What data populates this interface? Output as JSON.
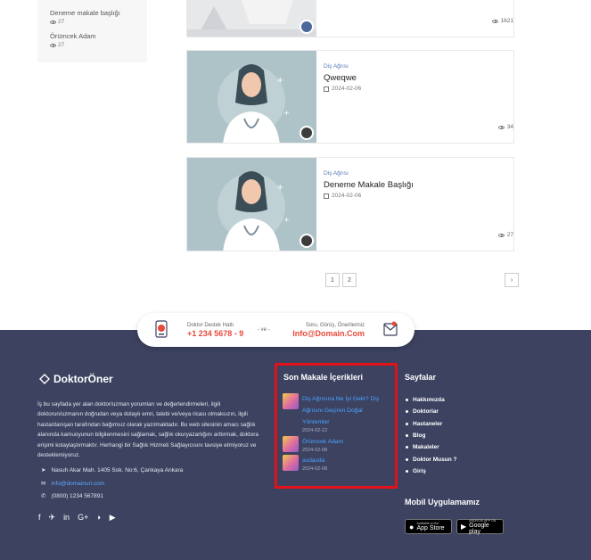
{
  "sidebar_list": [
    {
      "title": "Deneme makale başlığı",
      "views": "27"
    },
    {
      "title": "Örümcek Adam",
      "views": "27"
    }
  ],
  "articles": [
    {
      "category": "",
      "title": "",
      "date": "",
      "views": "1621"
    },
    {
      "category": "Diş Ağrısı",
      "title": "Qweqwe",
      "date": "2024-02-06",
      "views": "34"
    },
    {
      "category": "Diş Ağrısı",
      "title": "Deneme Makale Başlığı",
      "date": "2024-02-06",
      "views": "27"
    }
  ],
  "pagination": {
    "pages": [
      "1",
      "2"
    ],
    "next": "›"
  },
  "support": {
    "left_small": "Doktor Destek Hattı",
    "phone": "+1 234 5678 - 9",
    "separator": "- ve -",
    "right_small": "Soru, Görüş, Önerileriniz",
    "email": "Info@Domain.Com"
  },
  "footer": {
    "logo": "DoktorÖner",
    "about": "İş bu sayfada yer alan doktor/uzman yorumları ve değerlendirmeleri, ilgili doktorun/uzmanın doğrudan veya dolaylı emri, talebi ve/veya ricası olmaksızın, ilgili hasta/danışan tarafından bağımsız olarak yazılmaktadır. Bu web sitesinin amacı sağlık alanında kamuoyunun bilgilenmesini sağlamak, sağlık okuryazarlığını arttırmak, doktora erişimi kolaylaştırmaktır. Herhangi bir Sağlık Hizmeti Sağlayıcısını tavsiye etmiyoruz ve desteklemiyoruz.",
    "address": "Nasuh Akar Mah. 1405 Sok. No:6, Çankaya Ankara",
    "email": "info@domainuri.com",
    "phone": "(0800) 1234 567891",
    "recent_title": "Son Makale İçerikleri",
    "recent": [
      {
        "title": "Diş Ağrısına Ne İyi Gelir? Diş Ağrısını Geçiren Doğal Yöntemler",
        "date": "2024-02-12"
      },
      {
        "title": "Örümcek Adam",
        "date": "2024-02-08"
      },
      {
        "title": "asdasda",
        "date": "2024-02-08"
      }
    ],
    "pages_title": "Sayfalar",
    "pages": [
      "Hakkımızda",
      "Doktorlar",
      "Hastaneler",
      "Blog",
      "Makaleler",
      "Doktor Musun ?",
      "Giriş"
    ],
    "mobile_title": "Mobil Uygulamamız",
    "app_store": {
      "small": "Available on the",
      "big": "App Store"
    },
    "google_play": {
      "small": "ANDROID APP ON",
      "big": "Google play"
    }
  }
}
